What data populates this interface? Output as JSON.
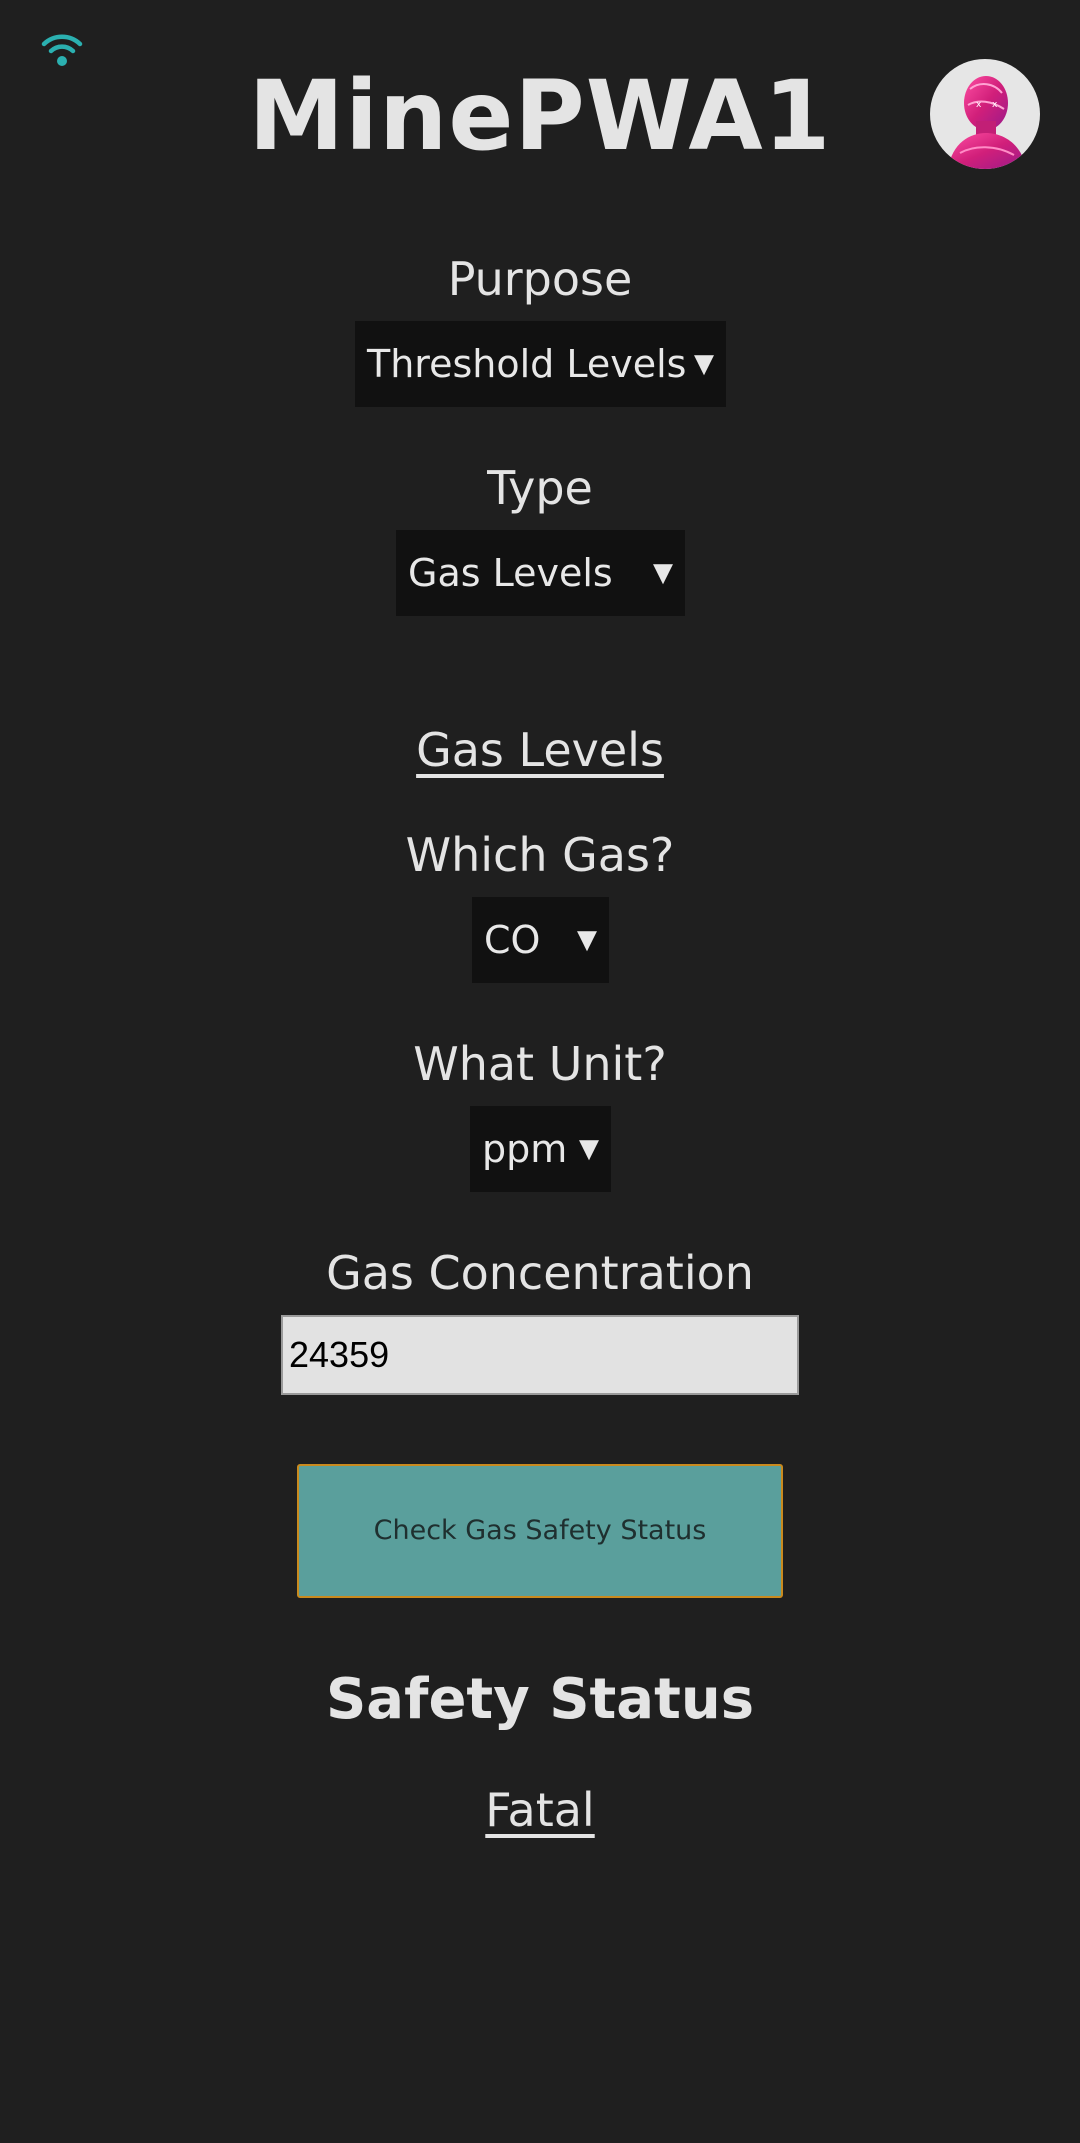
{
  "header": {
    "title": "MinePWA1",
    "wifi_icon": "wifi-icon",
    "avatar_icon": "user-avatar",
    "accent_color": "#2bb0b0"
  },
  "purpose": {
    "label": "Purpose",
    "selected": "Threshold Levels"
  },
  "type": {
    "label": "Type",
    "selected": "Gas Levels"
  },
  "section": {
    "heading": "Gas Levels"
  },
  "gas": {
    "label": "Which Gas?",
    "selected": "CO"
  },
  "unit": {
    "label": "What Unit?",
    "selected": "ppm"
  },
  "concentration": {
    "label": "Gas Concentration",
    "value": "24359"
  },
  "actions": {
    "check_label": "Check Gas Safety Status",
    "button_color": "#5a9f9c"
  },
  "result": {
    "title": "Safety Status",
    "value": "Fatal"
  }
}
